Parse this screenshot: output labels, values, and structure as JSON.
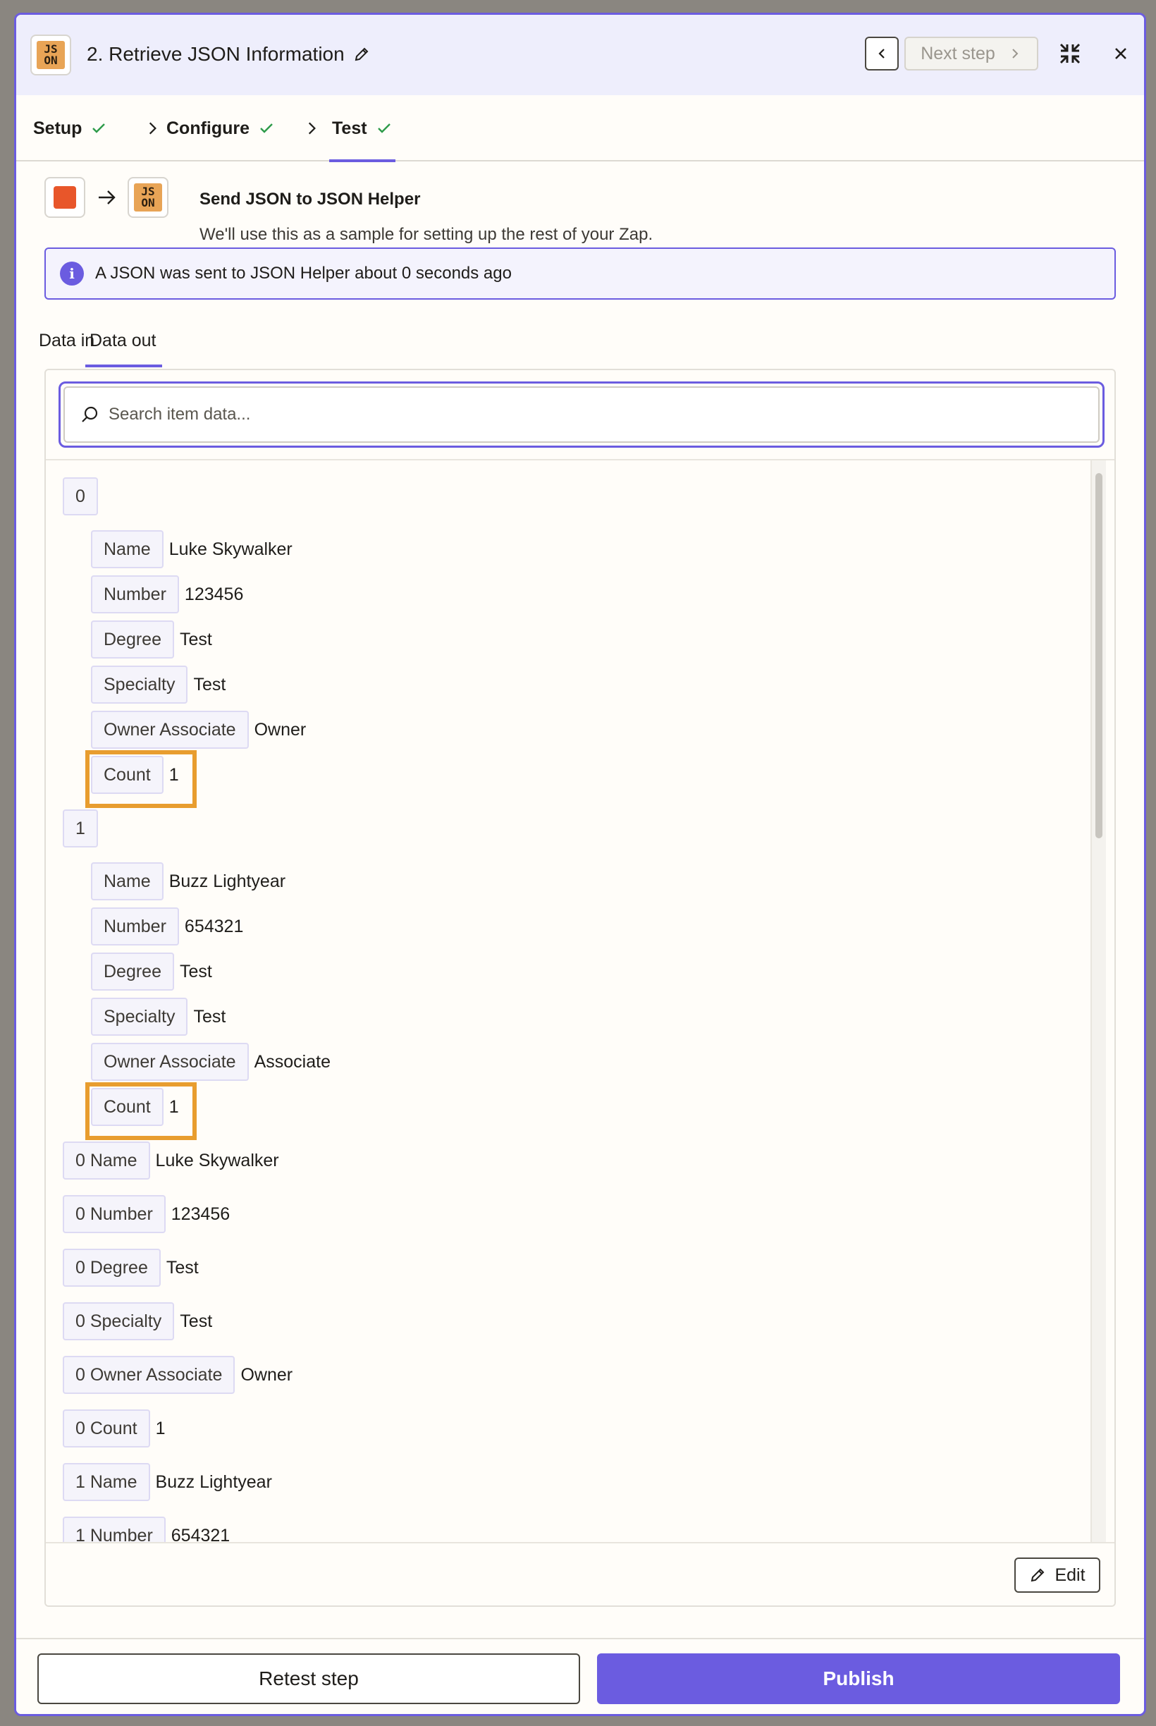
{
  "header": {
    "title": "2. Retrieve JSON Information",
    "next_step_label": "Next step",
    "app_logo_text": [
      "JS",
      "ON"
    ]
  },
  "steps": [
    {
      "label": "Setup",
      "done": true
    },
    {
      "label": "Configure",
      "done": true
    },
    {
      "label": "Test",
      "done": true,
      "active": true
    }
  ],
  "trigger": {
    "title": "Send JSON to JSON Helper",
    "subtitle": "We'll use this as a sample for setting up the rest of your Zap.",
    "source_color": "#e8562a"
  },
  "info_banner": {
    "text": "A JSON was sent to JSON Helper about 0 seconds ago"
  },
  "data_tabs": [
    {
      "label": "Data in",
      "active": false
    },
    {
      "label": "Data out",
      "active": true
    }
  ],
  "search": {
    "placeholder": "Search item data...",
    "value": ""
  },
  "tree": [
    {
      "key": "0",
      "value": "",
      "level": 0
    },
    {
      "key": "Name",
      "value": "Luke Skywalker",
      "level": 1
    },
    {
      "key": "Number",
      "value": "123456",
      "level": 1
    },
    {
      "key": "Degree",
      "value": "Test",
      "level": 1
    },
    {
      "key": "Specialty",
      "value": "Test",
      "level": 1
    },
    {
      "key": "Owner Associate",
      "value": "Owner",
      "level": 1
    },
    {
      "key": "Count",
      "value": "1",
      "level": 1,
      "highlighted": true
    },
    {
      "key": "1",
      "value": "",
      "level": 0
    },
    {
      "key": "Name",
      "value": "Buzz Lightyear",
      "level": 1
    },
    {
      "key": "Number",
      "value": "654321",
      "level": 1
    },
    {
      "key": "Degree",
      "value": "Test",
      "level": 1
    },
    {
      "key": "Specialty",
      "value": "Test",
      "level": 1
    },
    {
      "key": "Owner Associate",
      "value": "Associate",
      "level": 1
    },
    {
      "key": "Count",
      "value": "1",
      "level": 1,
      "highlighted": true
    },
    {
      "key": "0 Name",
      "value": "Luke Skywalker",
      "level": 0
    },
    {
      "key": "0 Number",
      "value": "123456",
      "level": 0
    },
    {
      "key": "0 Degree",
      "value": "Test",
      "level": 0
    },
    {
      "key": "0 Specialty",
      "value": "Test",
      "level": 0
    },
    {
      "key": "0 Owner Associate",
      "value": "Owner",
      "level": 0
    },
    {
      "key": "0 Count",
      "value": "1",
      "level": 0
    },
    {
      "key": "1 Name",
      "value": "Buzz Lightyear",
      "level": 0
    },
    {
      "key": "1 Number",
      "value": "654321",
      "level": 0
    }
  ],
  "card": {
    "edit_label": "Edit"
  },
  "footer": {
    "retest_label": "Retest step",
    "publish_label": "Publish"
  },
  "colors": {
    "accent": "#6b5ce0",
    "highlight": "#e89d2f",
    "check": "#2e9b4a"
  }
}
